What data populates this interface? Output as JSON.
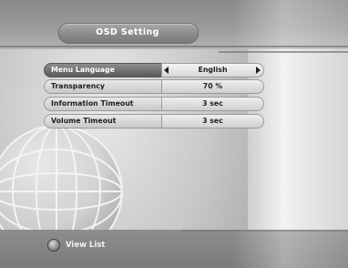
{
  "screen": {
    "title": "OSD Setting"
  },
  "settings": [
    {
      "label": "Menu Language",
      "value": "English",
      "selected": true
    },
    {
      "label": "Transparency",
      "value": "70 %",
      "selected": false
    },
    {
      "label": "Information Timeout",
      "value": "3 sec",
      "selected": false
    },
    {
      "label": "Volume Timeout",
      "value": "3 sec",
      "selected": false
    }
  ],
  "footer": {
    "help_label": "View List"
  },
  "icons": {
    "left_arrow": "chevron-left-icon",
    "right_arrow": "chevron-right-icon",
    "help_key": "remote-key-icon"
  },
  "colors": {
    "band": "#8a8a8a",
    "title_pill": "#8a8a8a",
    "selected_row": "#5a5a5a",
    "row": "#d8d8d8"
  }
}
